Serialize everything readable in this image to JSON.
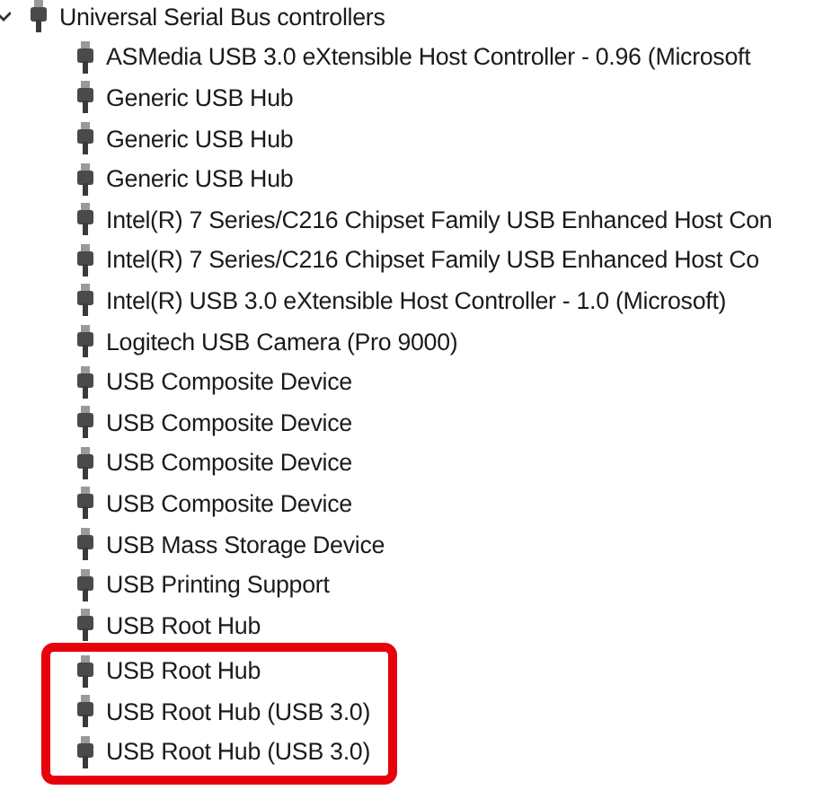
{
  "tree": {
    "label": "Universal Serial Bus controllers",
    "expanded": true,
    "children": [
      {
        "label": "ASMedia USB 3.0 eXtensible Host Controller - 0.96 (Microsoft",
        "highlighted": false
      },
      {
        "label": "Generic USB Hub",
        "highlighted": false
      },
      {
        "label": "Generic USB Hub",
        "highlighted": false
      },
      {
        "label": "Generic USB Hub",
        "highlighted": false
      },
      {
        "label": "Intel(R) 7 Series/C216 Chipset Family USB Enhanced Host Con",
        "highlighted": false
      },
      {
        "label": "Intel(R) 7 Series/C216 Chipset Family USB Enhanced Host Co",
        "highlighted": false
      },
      {
        "label": "Intel(R) USB 3.0 eXtensible Host Controller - 1.0 (Microsoft)",
        "highlighted": false
      },
      {
        "label": "Logitech USB Camera (Pro 9000)",
        "highlighted": false
      },
      {
        "label": "USB Composite Device",
        "highlighted": false
      },
      {
        "label": "USB Composite Device",
        "highlighted": false
      },
      {
        "label": "USB Composite Device",
        "highlighted": false
      },
      {
        "label": "USB Composite Device",
        "highlighted": false
      },
      {
        "label": "USB Mass Storage Device",
        "highlighted": false
      },
      {
        "label": "USB Printing Support",
        "highlighted": false
      },
      {
        "label": "USB Root Hub",
        "highlighted": false
      },
      {
        "label": "USB Root Hub",
        "highlighted": true
      },
      {
        "label": "USB Root Hub (USB 3.0)",
        "highlighted": true
      },
      {
        "label": "USB Root Hub (USB 3.0)",
        "highlighted": true
      }
    ]
  }
}
